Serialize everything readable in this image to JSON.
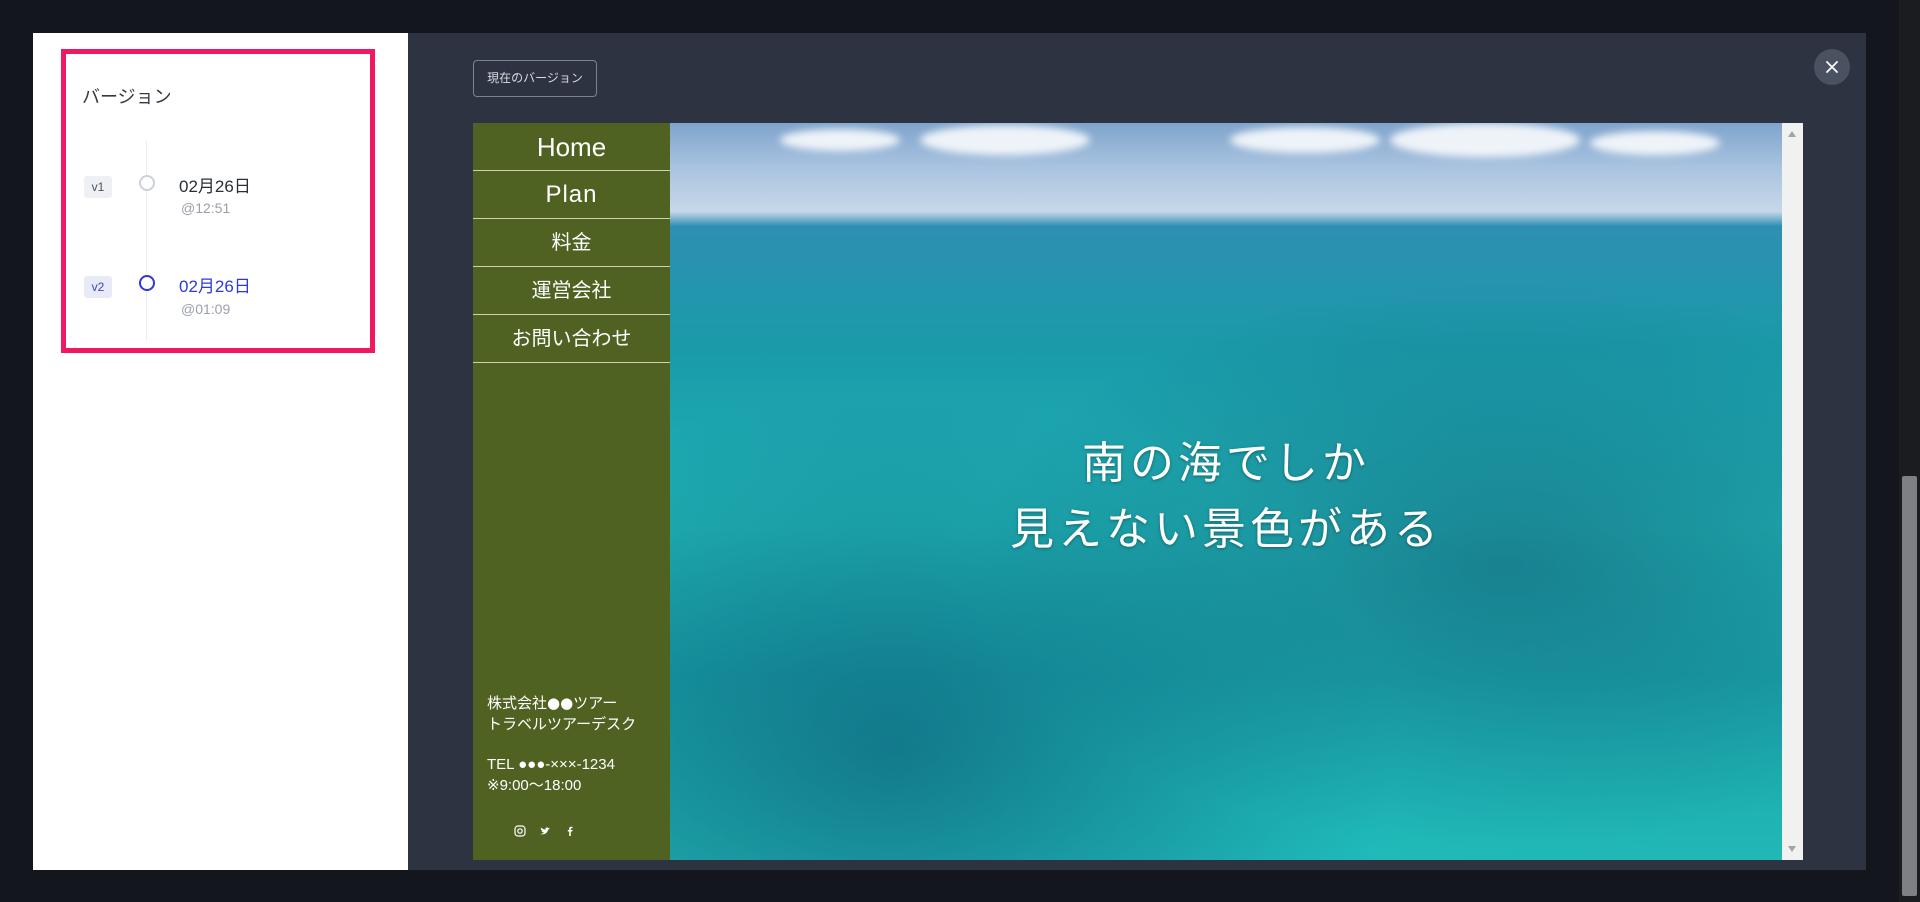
{
  "sidebar": {
    "title": "バージョン",
    "versions": [
      {
        "tag": "v1",
        "date": "02月26日",
        "time": "@12:51",
        "active": false
      },
      {
        "tag": "v2",
        "date": "02月26日",
        "time": "@01:09",
        "active": true
      }
    ]
  },
  "toolbar": {
    "current_version_label": "現在のバージョン",
    "close_icon": "close-icon"
  },
  "site": {
    "nav": [
      "Home",
      "Plan",
      "料金",
      "運営会社",
      "お問い合わせ"
    ],
    "company_line1": "株式会社●●ツアー",
    "company_line2": "トラベルツアーデスク",
    "tel": "TEL ●●●-×××-1234",
    "hours": "※9:00〜18:00",
    "social_icons": [
      "instagram-icon",
      "twitter-icon",
      "facebook-icon"
    ],
    "hero_line1": "南の海でしか",
    "hero_line2": "見えない景色がある"
  },
  "colors": {
    "highlight": "#f0185f",
    "active_version": "#2f38d8",
    "nav_green": "#4f6222",
    "modal_bg": "#2d3340"
  }
}
